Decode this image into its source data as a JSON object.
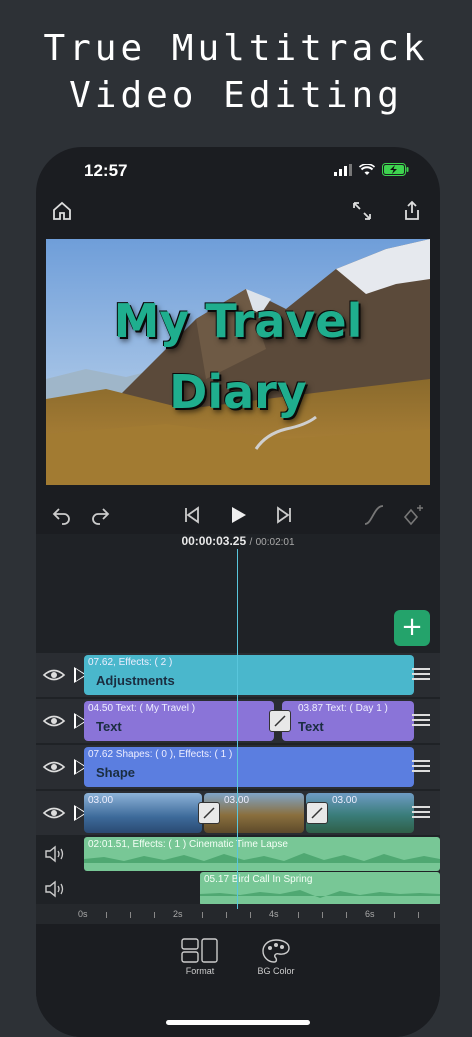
{
  "headline": {
    "line1": "True Multitrack",
    "line2": "Video Editing"
  },
  "status_bar": {
    "time": "12:57",
    "icons": [
      "signal-icon",
      "wifi-icon",
      "battery-charging-icon"
    ]
  },
  "toolbar": {
    "icons": [
      "home-icon",
      "fullscreen-icon",
      "share-icon"
    ]
  },
  "preview": {
    "title_line1": "My Travel",
    "title_line2": "Diary",
    "title_color": "#1fae8e"
  },
  "playback": {
    "icons": [
      "undo-icon",
      "redo-icon",
      "skip-back-icon",
      "play-icon",
      "skip-forward-icon",
      "curve-icon",
      "keyframe-add-icon"
    ]
  },
  "timecode": {
    "current": "00:00:03.25",
    "separator": "/",
    "total": "00:02:01"
  },
  "add_button": {
    "label": "+"
  },
  "tracks": [
    {
      "type": "adjustments",
      "color": "#4ab7cc",
      "clips": [
        {
          "meta": "07.62,  Effects: ( 2 )",
          "name": "Adjustments"
        }
      ]
    },
    {
      "type": "text",
      "color": "#8a74d8",
      "clips": [
        {
          "meta": "04.50  Text: ( My Travel )",
          "name": "Text"
        },
        {
          "meta": "03.87  Text: ( Day 1 )",
          "name": "Text"
        }
      ]
    },
    {
      "type": "shape",
      "color": "#5b7ee0",
      "clips": [
        {
          "meta": "07.62  Shapes: ( 0 ),  Effects: ( 1 )",
          "name": "Shape"
        }
      ]
    },
    {
      "type": "video",
      "color": "#4a7fb0",
      "clips": [
        {
          "meta": "03.00"
        },
        {
          "meta": "03.00"
        },
        {
          "meta": "03.00"
        }
      ]
    }
  ],
  "audio_tracks": [
    {
      "meta": "02:01.51,  Effects: ( 1 ) Cinematic Time Lapse",
      "color": "#78c796"
    },
    {
      "meta": "05.17 Bird Call In Spring",
      "color": "#78c796"
    }
  ],
  "ruler": {
    "labels": [
      "0s",
      "2s",
      "4s",
      "6s"
    ]
  },
  "bottom_tools": [
    {
      "label": "Format",
      "icon": "format-icon"
    },
    {
      "label": "BG Color",
      "icon": "palette-icon"
    }
  ]
}
